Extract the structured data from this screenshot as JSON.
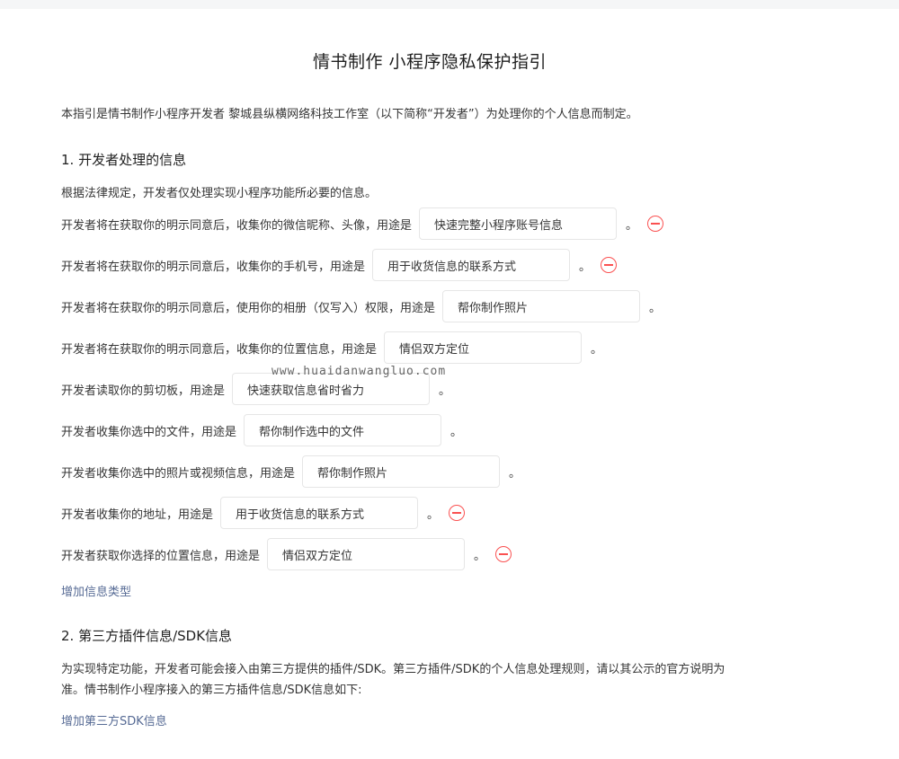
{
  "page": {
    "title": "情书制作 小程序隐私保护指引",
    "intro": "本指引是情书制作小程序开发者 黎城县纵横网络科技工作室（以下简称“开发者”）为处理你的个人信息而制定。"
  },
  "section1": {
    "heading": "1. 开发者处理的信息",
    "desc": "根据法律规定，开发者仅处理实现小程序功能所必要的信息。",
    "rows": [
      {
        "label": "开发者将在获取你的明示同意后，收集你的微信昵称、头像，用途是",
        "value": "快速完整小程序账号信息",
        "punct": "。"
      },
      {
        "label": "开发者将在获取你的明示同意后，收集你的手机号，用途是",
        "value": "用于收货信息的联系方式",
        "punct": "。"
      },
      {
        "label": "开发者将在获取你的明示同意后，使用你的相册（仅写入）权限，用途是",
        "value": "帮你制作照片",
        "punct": "。"
      },
      {
        "label": "开发者将在获取你的明示同意后，收集你的位置信息，用途是",
        "value": "情侣双方定位",
        "punct": "。"
      },
      {
        "label": "开发者读取你的剪切板，用途是",
        "value": "快速获取信息省时省力",
        "punct": "。"
      },
      {
        "label": "开发者收集你选中的文件，用途是",
        "value": "帮你制作选中的文件",
        "punct": "。"
      },
      {
        "label": "开发者收集你选中的照片或视频信息，用途是",
        "value": "帮你制作照片",
        "punct": "。"
      },
      {
        "label": "开发者收集你的地址，用途是",
        "value": "用于收货信息的联系方式",
        "punct": "。"
      },
      {
        "label": "开发者获取你选择的位置信息，用途是",
        "value": "情侣双方定位",
        "punct": "。"
      }
    ],
    "add_link": "增加信息类型"
  },
  "section2": {
    "heading": "2. 第三方插件信息/SDK信息",
    "desc_line1": "为实现特定功能，开发者可能会接入由第三方提供的插件/SDK。第三方插件/SDK的个人信息处理规则，请以其公示的官方说明为",
    "desc_line2": "准。情书制作小程序接入的第三方插件信息/SDK信息如下:",
    "add_link": "增加第三方SDK信息"
  },
  "watermark": "www.huaidanwangluo.com",
  "colors": {
    "link": "#576b95",
    "remove": "#fa5151",
    "border": "#e6e6e6"
  }
}
